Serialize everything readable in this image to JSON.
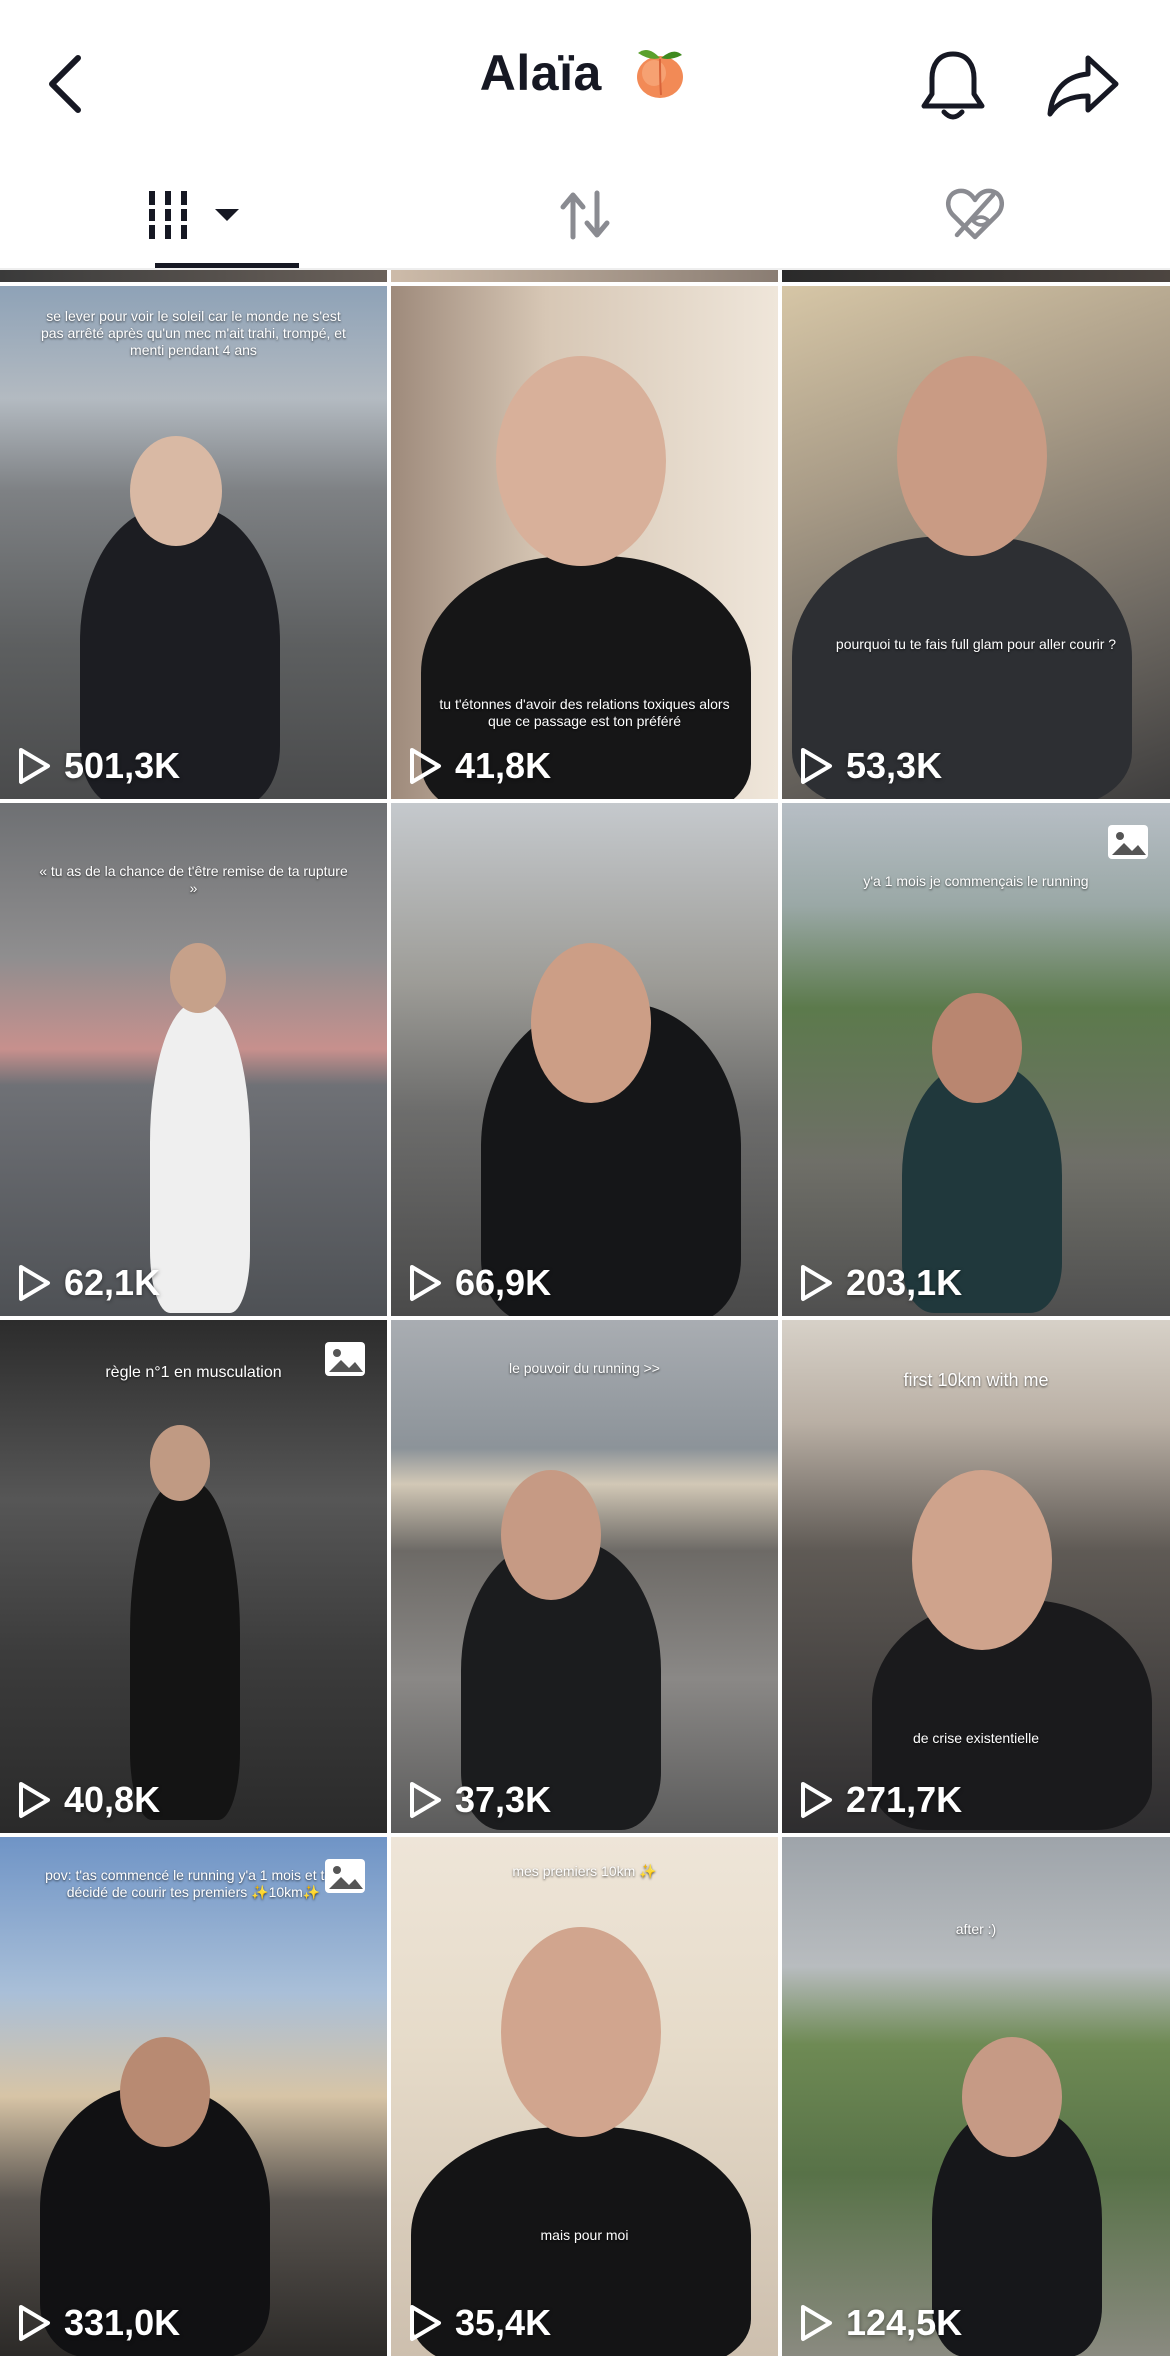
{
  "header": {
    "title": "Alaïa",
    "emoji_icon": "peach-emoji"
  },
  "tabs": [
    {
      "name": "videos",
      "icon": "grid-icon",
      "active": true
    },
    {
      "name": "reposts",
      "icon": "repost-icon",
      "active": false
    },
    {
      "name": "liked",
      "icon": "hidden-heart-icon",
      "active": false
    }
  ],
  "videos": [
    {
      "views": "501,3K",
      "caption": "se lever pour voir le soleil car le monde ne s'est pas arrêté après qu'un mec m'ait trahi, trompé, et menti pendant 4 ans",
      "is_photo": false
    },
    {
      "views": "41,8K",
      "caption": "tu t'étonnes d'avoir des relations toxiques alors que ce passage est ton préféré",
      "is_photo": false
    },
    {
      "views": "53,3K",
      "caption": "pourquoi tu te fais full glam pour aller courir ?",
      "is_photo": false
    },
    {
      "views": "62,1K",
      "caption": "« tu as de la chance de t'être remise de ta rupture »",
      "is_photo": false
    },
    {
      "views": "66,9K",
      "caption": "",
      "is_photo": false
    },
    {
      "views": "203,1K",
      "caption": "y'a 1 mois je commençais le running",
      "is_photo": true
    },
    {
      "views": "40,8K",
      "caption": "règle n°1 en musculation",
      "is_photo": true
    },
    {
      "views": "37,3K",
      "caption": "le pouvoir du running >>",
      "is_photo": false
    },
    {
      "views": "271,7K",
      "caption": "first 10km with me",
      "caption2": "de crise existentielle",
      "is_photo": false
    },
    {
      "views": "331,0K",
      "caption": "pov: t'as commencé le running y'a 1 mois et t'as décidé de courir tes premiers ✨10km✨",
      "is_photo": true
    },
    {
      "views": "35,4K",
      "caption": "mes premiers 10km ✨",
      "caption2": "mais pour moi",
      "is_photo": false
    },
    {
      "views": "124,5K",
      "caption": "after :)",
      "is_photo": false
    }
  ],
  "colors": {
    "text_primary": "#161823",
    "tab_inactive": "#8a8b91",
    "overlay_text": "#ffffff"
  }
}
